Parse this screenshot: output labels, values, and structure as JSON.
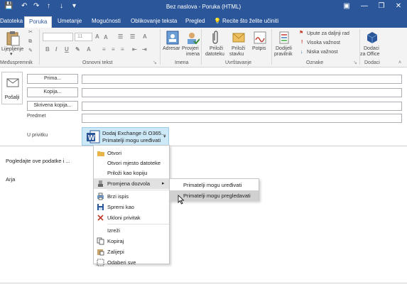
{
  "window": {
    "title": "Bez naslova - Poruka (HTML)",
    "minimize": "—",
    "restore": "❐",
    "close": "✕",
    "titlebar_color": "#2b579a"
  },
  "quick_access": {
    "save": "💾",
    "undo": "↶",
    "redo": "↷",
    "up": "↑",
    "down": "↓",
    "more": "▾"
  },
  "tabs": [
    {
      "label": "Datoteka"
    },
    {
      "label": "Poruka"
    },
    {
      "label": "Umetanje"
    },
    {
      "label": "Mogućnosti"
    },
    {
      "label": "Oblikovanje teksta"
    },
    {
      "label": "Pregled"
    },
    {
      "label": "Recite što želite učiniti"
    }
  ],
  "ribbon": {
    "paste_label": "Lijepljenje",
    "clipboard_group": "Međuspremnik",
    "basic_text_group": "Osnovni tekst",
    "format_buttons": [
      "B",
      "I",
      "U"
    ],
    "names_group": "Imena",
    "address_book": "Adresar",
    "check_names_line1": "Provjeri",
    "check_names_line2": "imena",
    "include_group": "Uvrštavanje",
    "attach_file_line1": "Priloži",
    "attach_file_line2": "datoteku",
    "attach_item_line1": "Priloži",
    "attach_item_line2": "stavku",
    "signature": "Potpis",
    "tags_group": "Oznake",
    "assign_policy_line1": "Dodijeli",
    "assign_policy_line2": "pravilnik",
    "follow_up": "Upute za daljnji rad",
    "high_importance": "Visoka važnost",
    "low_importance": "Niska važnost",
    "addins_group": "Dodaci",
    "office_addins_line1": "Dodaci",
    "office_addins_line2": "za Office",
    "font_size": "11",
    "accent_color": "#2b579a"
  },
  "compose": {
    "send_label": "Pošalji",
    "to_button": "Prima...",
    "cc_button": "Kopija...",
    "bcc_button": "Skrivena kopija...",
    "subject_label": "Predmet",
    "attached_label": "U privitku",
    "attachment_name": "Dodaj Exchange či O365...",
    "attachment_perm": "Primatelji mogu uređivati",
    "body_line1": "Pogledajte ove podatke i ...",
    "body_line2": "Arja"
  },
  "context_menu": {
    "items": [
      {
        "label": "Otvori"
      },
      {
        "label": "Otvori mjesto datoteke"
      },
      {
        "label": "Priloži kao kopiju"
      },
      {
        "label": "Promjena dozvola"
      },
      {
        "label": "Brzi ispis"
      },
      {
        "label": "Spremi kao"
      },
      {
        "label": "Ukloni privitak"
      },
      {
        "label": "Izreži"
      },
      {
        "label": "Kopiraj"
      },
      {
        "label": "Zalijepi"
      },
      {
        "label": "Odaberi sve"
      }
    ],
    "submenu_arrow": "▸"
  },
  "submenu": {
    "items": [
      {
        "label": "Primatelji mogu uređivati"
      },
      {
        "label": "Primatelji mogu pregledavati"
      }
    ]
  }
}
